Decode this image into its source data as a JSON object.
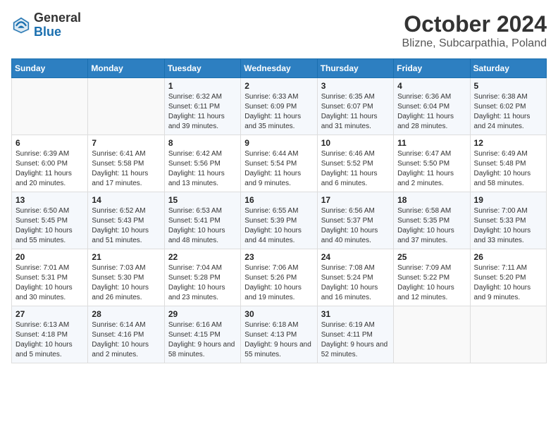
{
  "header": {
    "logo_general": "General",
    "logo_blue": "Blue",
    "month_title": "October 2024",
    "location": "Blizne, Subcarpathia, Poland"
  },
  "weekdays": [
    "Sunday",
    "Monday",
    "Tuesday",
    "Wednesday",
    "Thursday",
    "Friday",
    "Saturday"
  ],
  "weeks": [
    [
      {
        "day": "",
        "info": ""
      },
      {
        "day": "",
        "info": ""
      },
      {
        "day": "1",
        "info": "Sunrise: 6:32 AM\nSunset: 6:11 PM\nDaylight: 11 hours and 39 minutes."
      },
      {
        "day": "2",
        "info": "Sunrise: 6:33 AM\nSunset: 6:09 PM\nDaylight: 11 hours and 35 minutes."
      },
      {
        "day": "3",
        "info": "Sunrise: 6:35 AM\nSunset: 6:07 PM\nDaylight: 11 hours and 31 minutes."
      },
      {
        "day": "4",
        "info": "Sunrise: 6:36 AM\nSunset: 6:04 PM\nDaylight: 11 hours and 28 minutes."
      },
      {
        "day": "5",
        "info": "Sunrise: 6:38 AM\nSunset: 6:02 PM\nDaylight: 11 hours and 24 minutes."
      }
    ],
    [
      {
        "day": "6",
        "info": "Sunrise: 6:39 AM\nSunset: 6:00 PM\nDaylight: 11 hours and 20 minutes."
      },
      {
        "day": "7",
        "info": "Sunrise: 6:41 AM\nSunset: 5:58 PM\nDaylight: 11 hours and 17 minutes."
      },
      {
        "day": "8",
        "info": "Sunrise: 6:42 AM\nSunset: 5:56 PM\nDaylight: 11 hours and 13 minutes."
      },
      {
        "day": "9",
        "info": "Sunrise: 6:44 AM\nSunset: 5:54 PM\nDaylight: 11 hours and 9 minutes."
      },
      {
        "day": "10",
        "info": "Sunrise: 6:46 AM\nSunset: 5:52 PM\nDaylight: 11 hours and 6 minutes."
      },
      {
        "day": "11",
        "info": "Sunrise: 6:47 AM\nSunset: 5:50 PM\nDaylight: 11 hours and 2 minutes."
      },
      {
        "day": "12",
        "info": "Sunrise: 6:49 AM\nSunset: 5:48 PM\nDaylight: 10 hours and 58 minutes."
      }
    ],
    [
      {
        "day": "13",
        "info": "Sunrise: 6:50 AM\nSunset: 5:45 PM\nDaylight: 10 hours and 55 minutes."
      },
      {
        "day": "14",
        "info": "Sunrise: 6:52 AM\nSunset: 5:43 PM\nDaylight: 10 hours and 51 minutes."
      },
      {
        "day": "15",
        "info": "Sunrise: 6:53 AM\nSunset: 5:41 PM\nDaylight: 10 hours and 48 minutes."
      },
      {
        "day": "16",
        "info": "Sunrise: 6:55 AM\nSunset: 5:39 PM\nDaylight: 10 hours and 44 minutes."
      },
      {
        "day": "17",
        "info": "Sunrise: 6:56 AM\nSunset: 5:37 PM\nDaylight: 10 hours and 40 minutes."
      },
      {
        "day": "18",
        "info": "Sunrise: 6:58 AM\nSunset: 5:35 PM\nDaylight: 10 hours and 37 minutes."
      },
      {
        "day": "19",
        "info": "Sunrise: 7:00 AM\nSunset: 5:33 PM\nDaylight: 10 hours and 33 minutes."
      }
    ],
    [
      {
        "day": "20",
        "info": "Sunrise: 7:01 AM\nSunset: 5:31 PM\nDaylight: 10 hours and 30 minutes."
      },
      {
        "day": "21",
        "info": "Sunrise: 7:03 AM\nSunset: 5:30 PM\nDaylight: 10 hours and 26 minutes."
      },
      {
        "day": "22",
        "info": "Sunrise: 7:04 AM\nSunset: 5:28 PM\nDaylight: 10 hours and 23 minutes."
      },
      {
        "day": "23",
        "info": "Sunrise: 7:06 AM\nSunset: 5:26 PM\nDaylight: 10 hours and 19 minutes."
      },
      {
        "day": "24",
        "info": "Sunrise: 7:08 AM\nSunset: 5:24 PM\nDaylight: 10 hours and 16 minutes."
      },
      {
        "day": "25",
        "info": "Sunrise: 7:09 AM\nSunset: 5:22 PM\nDaylight: 10 hours and 12 minutes."
      },
      {
        "day": "26",
        "info": "Sunrise: 7:11 AM\nSunset: 5:20 PM\nDaylight: 10 hours and 9 minutes."
      }
    ],
    [
      {
        "day": "27",
        "info": "Sunrise: 6:13 AM\nSunset: 4:18 PM\nDaylight: 10 hours and 5 minutes."
      },
      {
        "day": "28",
        "info": "Sunrise: 6:14 AM\nSunset: 4:16 PM\nDaylight: 10 hours and 2 minutes."
      },
      {
        "day": "29",
        "info": "Sunrise: 6:16 AM\nSunset: 4:15 PM\nDaylight: 9 hours and 58 minutes."
      },
      {
        "day": "30",
        "info": "Sunrise: 6:18 AM\nSunset: 4:13 PM\nDaylight: 9 hours and 55 minutes."
      },
      {
        "day": "31",
        "info": "Sunrise: 6:19 AM\nSunset: 4:11 PM\nDaylight: 9 hours and 52 minutes."
      },
      {
        "day": "",
        "info": ""
      },
      {
        "day": "",
        "info": ""
      }
    ]
  ]
}
